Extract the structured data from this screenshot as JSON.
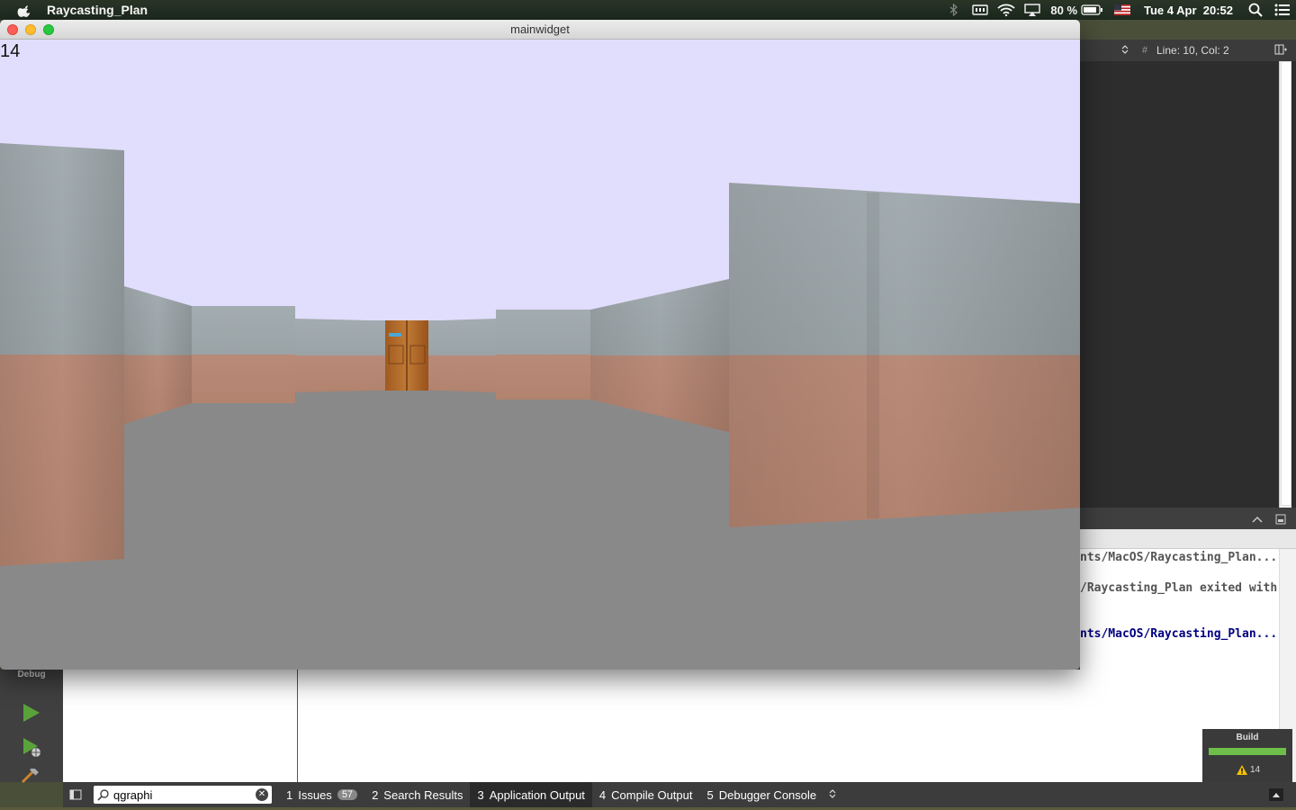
{
  "menubar": {
    "app_name": "Raycasting_Plan",
    "battery": "80 %",
    "datetime": "Tue 4 Apr  20:52"
  },
  "window": {
    "title": "mainwidget",
    "counter": "14"
  },
  "editor": {
    "position": "Line: 10, Col: 2"
  },
  "output": {
    "lines": [
      "nts/MacOS/Raycasting_Plan...",
      "/Raycasting_Plan exited with",
      "nts/MacOS/Raycasting_Plan..."
    ],
    "line_colors": [
      "#555555",
      "#555555",
      "#000080"
    ]
  },
  "sidebar": {
    "mode_label": "Debug"
  },
  "build": {
    "label": "Build",
    "warnings": "14"
  },
  "statusbar": {
    "search_value": "qgraphi",
    "tabs": [
      {
        "num": "1",
        "label": "Issues",
        "badge": "57"
      },
      {
        "num": "2",
        "label": "Search Results"
      },
      {
        "num": "3",
        "label": "Application Output"
      },
      {
        "num": "4",
        "label": "Compile Output"
      },
      {
        "num": "5",
        "label": "Debugger Console"
      }
    ]
  },
  "colors": {
    "sky": "#e1ddfc",
    "floor": "#898989",
    "wall_top": "#a0a9ad",
    "wall_bottom": "#b58776"
  }
}
